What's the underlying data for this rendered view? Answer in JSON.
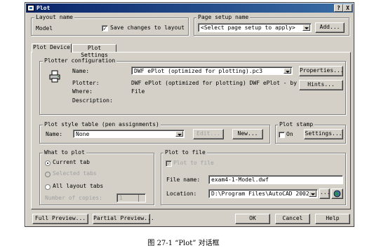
{
  "window": {
    "title": "Plot"
  },
  "title_buttons": {
    "help": "?",
    "close": "X"
  },
  "layout_name": {
    "group_label": "Layout name",
    "value": "Model",
    "save_checkbox_label": "Save changes to layout",
    "save_checked": true
  },
  "page_setup": {
    "group_label": "Page setup name",
    "selected": "<Select page setup to apply>",
    "add_button": "Add..."
  },
  "tabs": [
    {
      "label": "Plot Device",
      "active": true
    },
    {
      "label": "Plot Settings",
      "active": false
    }
  ],
  "plotter": {
    "group_label": "Plotter configuration",
    "name_label": "Name:",
    "name_value": "DWF ePlot (optimized for plotting).pc3",
    "properties_button": "Properties...",
    "plotter_label": "Plotter:",
    "plotter_value": "DWF ePlot (optimized for plotting) DWF ePlot - by",
    "hints_button": "Hints...",
    "where_label": "Where:",
    "where_value": "File",
    "description_label": "Description:"
  },
  "plot_style": {
    "group_label": "Plot style table (pen assignments)",
    "name_label": "Name:",
    "name_value": "None",
    "edit_button": "Edit...",
    "new_button": "New..."
  },
  "plot_stamp": {
    "group_label": "Plot stamp",
    "on_label": "On",
    "on_checked": false,
    "settings_button": "Settings..."
  },
  "what_to_plot": {
    "group_label": "What to plot",
    "options": [
      {
        "label": "Current tab",
        "selected": true,
        "enabled": true
      },
      {
        "label": "Selected tabs",
        "selected": false,
        "enabled": false
      },
      {
        "label": "All layout tabs",
        "selected": false,
        "enabled": true
      }
    ],
    "copies_label": "Number of copies:",
    "copies_value": "1"
  },
  "plot_to_file": {
    "group_label": "Plot to file",
    "checkbox_label": "Plot to file",
    "checked": true,
    "file_name_label": "File name:",
    "file_name_value": "exam4-1-Model.dwf",
    "location_label": "Location:",
    "location_value": "D:\\Program Files\\AutoCAD 2002\\",
    "browse_button": "..."
  },
  "footer": {
    "full_preview": "Full Preview...",
    "partial_preview": "Partial Preview...",
    "ok": "OK",
    "cancel": "Cancel",
    "help": "Help"
  },
  "caption": "图 27-1  “Plot” 对话框"
}
